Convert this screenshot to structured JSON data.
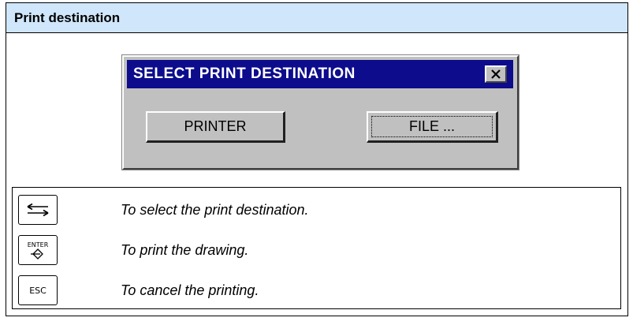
{
  "section": {
    "title": "Print destination"
  },
  "dialog": {
    "caption": "SELECT PRINT DESTINATION",
    "close_icon": "close-icon",
    "buttons": {
      "printer": "PRINTER",
      "file": "FILE ..."
    }
  },
  "keys": [
    {
      "icon": "tab-arrows-key-icon",
      "description": "To select the print destination."
    },
    {
      "icon": "enter-key-icon",
      "label": "ENTER",
      "description": "To print the drawing."
    },
    {
      "icon": "esc-key-icon",
      "label": "ESC",
      "description": "To cancel the printing."
    }
  ],
  "colors": {
    "header_bg": "#cfe6fb",
    "dialog_caption_bg": "#0c0c8c",
    "dialog_bg": "#c0c0c0"
  }
}
